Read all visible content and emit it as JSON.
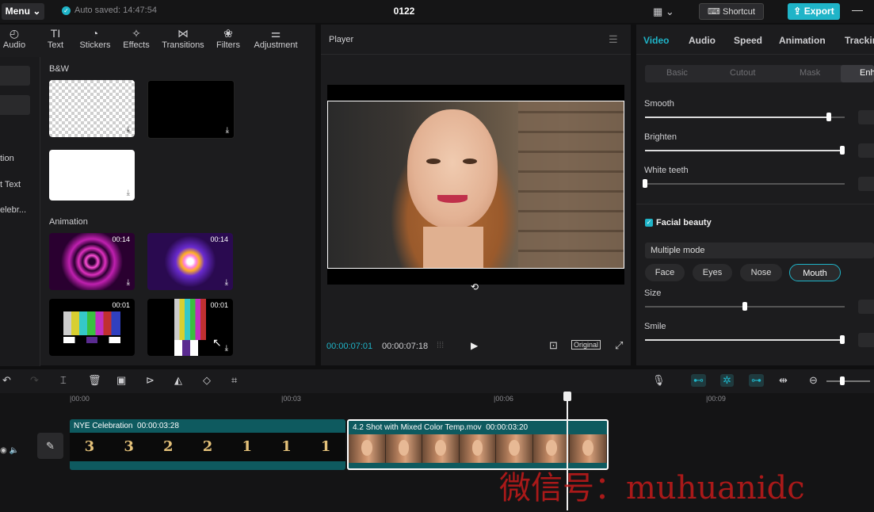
{
  "topbar": {
    "menu_label": "Menu",
    "autosave": "Auto saved: 14:47:54",
    "project_title": "0122",
    "shortcut_label": "Shortcut",
    "export_label": "Export"
  },
  "toolbar_tabs": [
    {
      "label": "Audio",
      "icon": "audio-icon"
    },
    {
      "label": "Text",
      "icon": "text-icon"
    },
    {
      "label": "Stickers",
      "icon": "sticker-icon"
    },
    {
      "label": "Effects",
      "icon": "effects-icon"
    },
    {
      "label": "Transitions",
      "icon": "transitions-icon"
    },
    {
      "label": "Filters",
      "icon": "filters-icon"
    },
    {
      "label": "Adjustment",
      "icon": "adjustment-icon"
    }
  ],
  "side_nav": [
    "tion",
    "t Text",
    "elebr..."
  ],
  "sections": {
    "bw_title": "B&W",
    "animation_title": "Animation"
  },
  "thumbs": {
    "anim1_dur": "00:14",
    "anim2_dur": "00:14",
    "anim3_dur": "00:01",
    "anim4_dur": "00:01"
  },
  "player": {
    "title": "Player",
    "current_time": "00:00:07:01",
    "total_time": "00:00:07:18",
    "original_label": "Original"
  },
  "right_panel": {
    "tabs": [
      "Video",
      "Audio",
      "Speed",
      "Animation",
      "Trackin"
    ],
    "active_tab": "Video",
    "subtabs": [
      "Basic",
      "Cutout",
      "Mask",
      "Enh"
    ],
    "sliders": [
      {
        "label": "Smooth",
        "value": 0.92
      },
      {
        "label": "Brighten",
        "value": 0.99
      },
      {
        "label": "White teeth",
        "value": 0.0
      }
    ],
    "facial_beauty_label": "Facial beauty",
    "mode_label": "Multiple mode",
    "features": [
      "Face",
      "Eyes",
      "Nose",
      "Mouth"
    ],
    "active_feature": "Mouth",
    "feature_sliders": [
      {
        "label": "Size",
        "value": 0.5
      },
      {
        "label": "Smile",
        "value": 0.99
      }
    ]
  },
  "timeline": {
    "ruler": [
      "|00:00",
      "|00:03",
      "|00:06",
      "|00:09"
    ],
    "clips": [
      {
        "name": "NYE Celebration",
        "duration": "00:00:03:28"
      },
      {
        "name": "4.2 Shot with Mixed Color Temp.mov",
        "duration": "00:00:03:20"
      }
    ],
    "clip1_frames": [
      "3",
      "3",
      "2",
      "2",
      "1",
      "1",
      "1"
    ]
  },
  "watermark": "微信号：muhuanidc",
  "colors": {
    "accent": "#1fb4c8",
    "clip": "#0e5a5f",
    "watermark": "#c41a1a"
  }
}
